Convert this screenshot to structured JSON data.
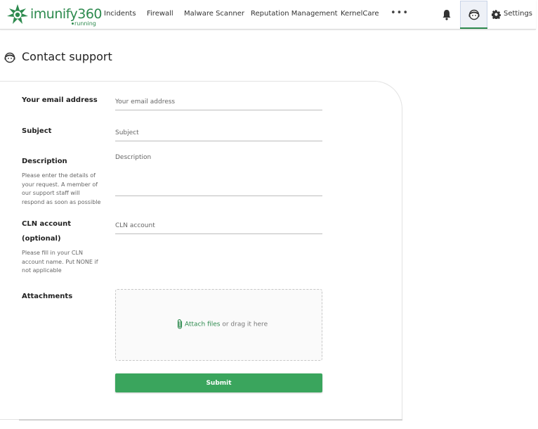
{
  "app": {
    "logo_text": "imunify360",
    "status": "running",
    "brand_color": "#2d8a4e",
    "accent_color": "#3aa55d"
  },
  "nav": {
    "items": [
      {
        "label": "Incidents"
      },
      {
        "label": "Firewall"
      },
      {
        "label": "Malware Scanner"
      },
      {
        "label": "Reputation Management"
      },
      {
        "label": "KernelCare"
      }
    ],
    "more_label": "•••",
    "settings_label": "Settings",
    "icons": [
      "bell-icon",
      "support-agent-icon",
      "gear-icon"
    ]
  },
  "page": {
    "title": "Contact support",
    "icon": "support-agent-icon"
  },
  "form": {
    "email": {
      "label": "Your email address",
      "placeholder": "Your email address",
      "value": ""
    },
    "subject": {
      "label": "Subject",
      "placeholder": "Subject",
      "value": ""
    },
    "description": {
      "label": "Description",
      "hint": "Please enter the details of your request. A member of our support staff will respond as soon as possible",
      "placeholder": "Description",
      "value": ""
    },
    "cln": {
      "label": "CLN account",
      "label_suffix": "(optional)",
      "hint": "Please fill in your CLN account name. Put NONE if not applicable",
      "placeholder": "CLN account",
      "value": ""
    },
    "attachments": {
      "label": "Attachments",
      "link_text": "Attach files",
      "rest_text": "or drag it here",
      "icon": "paperclip-icon"
    },
    "submit_label": "Submit"
  }
}
